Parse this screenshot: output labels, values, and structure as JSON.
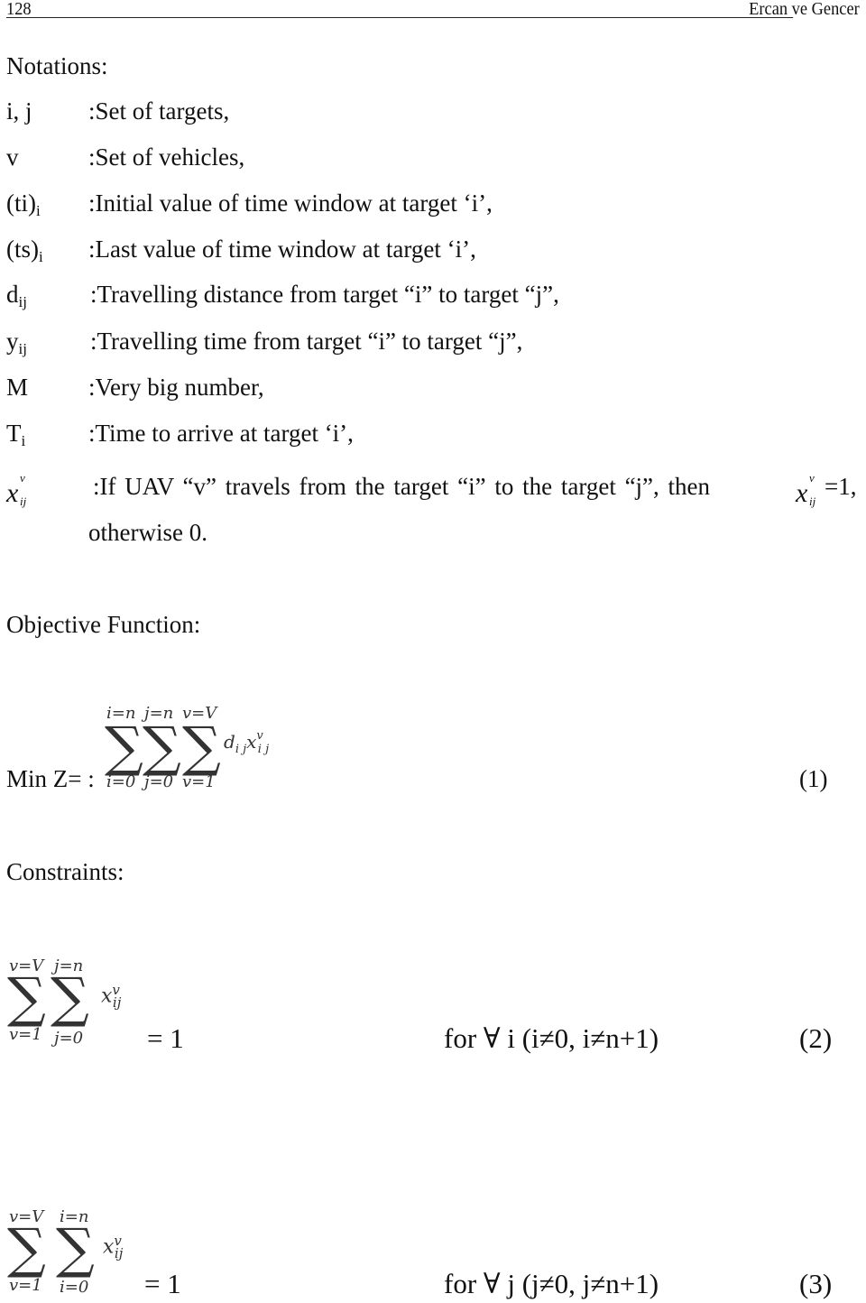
{
  "header": {
    "page_number": "128",
    "authors": "Ercan ve Gencer"
  },
  "notations": {
    "title": "Notations:",
    "items": [
      {
        "symbol": "i, j",
        "symbol_sub": "",
        "desc": ":Set of targets,"
      },
      {
        "symbol": "v",
        "symbol_sub": "",
        "desc": ":Set of vehicles,"
      },
      {
        "symbol": "(ti)",
        "symbol_sub": "i",
        "desc": ":Initial value of time window at target ‘i’,"
      },
      {
        "symbol": "(ts)",
        "symbol_sub": "i",
        "desc": ":Last value of time window at target ‘i’,"
      },
      {
        "symbol": "d",
        "symbol_sub": "ij",
        "desc": ":Travelling distance from target “i” to  target “j”,"
      },
      {
        "symbol": "y",
        "symbol_sub": "ij",
        "desc": ":Travelling time from target “i” to target “j”,"
      },
      {
        "symbol": "M",
        "symbol_sub": "",
        "desc": ":Very big number,"
      },
      {
        "symbol": "T",
        "symbol_sub": "i",
        "desc": ":Time to arrive at target ‘i’,"
      }
    ],
    "x_item": {
      "symbol": "x",
      "sup": "v",
      "sub": "ij",
      "desc": ":If UAV “v” travels from the target “i” to the target “j”, then",
      "desc_tail": "=1,",
      "desc_line2": "otherwise 0."
    }
  },
  "objective": {
    "title": "Objective Function:",
    "prefix": "Min Z= :",
    "sums": [
      {
        "upper": "i=n",
        "lower": "i=0"
      },
      {
        "upper": "j=n",
        "lower": "j=0"
      },
      {
        "upper": "v=V",
        "lower": "v=1"
      }
    ],
    "term": "d",
    "term_sub": "i j",
    "var": "x",
    "var_sup": "v",
    "var_sub": "i j",
    "eq_number": "(1)"
  },
  "constraints": {
    "title": "Constraints:",
    "items": [
      {
        "sums": [
          {
            "upper": "v=V",
            "lower": "v=1"
          },
          {
            "upper": "j=n",
            "lower": "j=0"
          }
        ],
        "var": "x",
        "var_sup": "v",
        "var_sub": "ij",
        "rhs": "= 1",
        "condition": "for ∀ i (i≠0, i≠n+1)",
        "eq_number": "(2)"
      },
      {
        "sums": [
          {
            "upper": "v=V",
            "lower": "v=1"
          },
          {
            "upper": "i=n",
            "lower": "i=0"
          }
        ],
        "var": "x",
        "var_sup": "v",
        "var_sub": "ij",
        "rhs": "= 1",
        "condition": "for ∀ j (j≠0, j≠n+1)",
        "eq_number": "(3)"
      }
    ]
  }
}
